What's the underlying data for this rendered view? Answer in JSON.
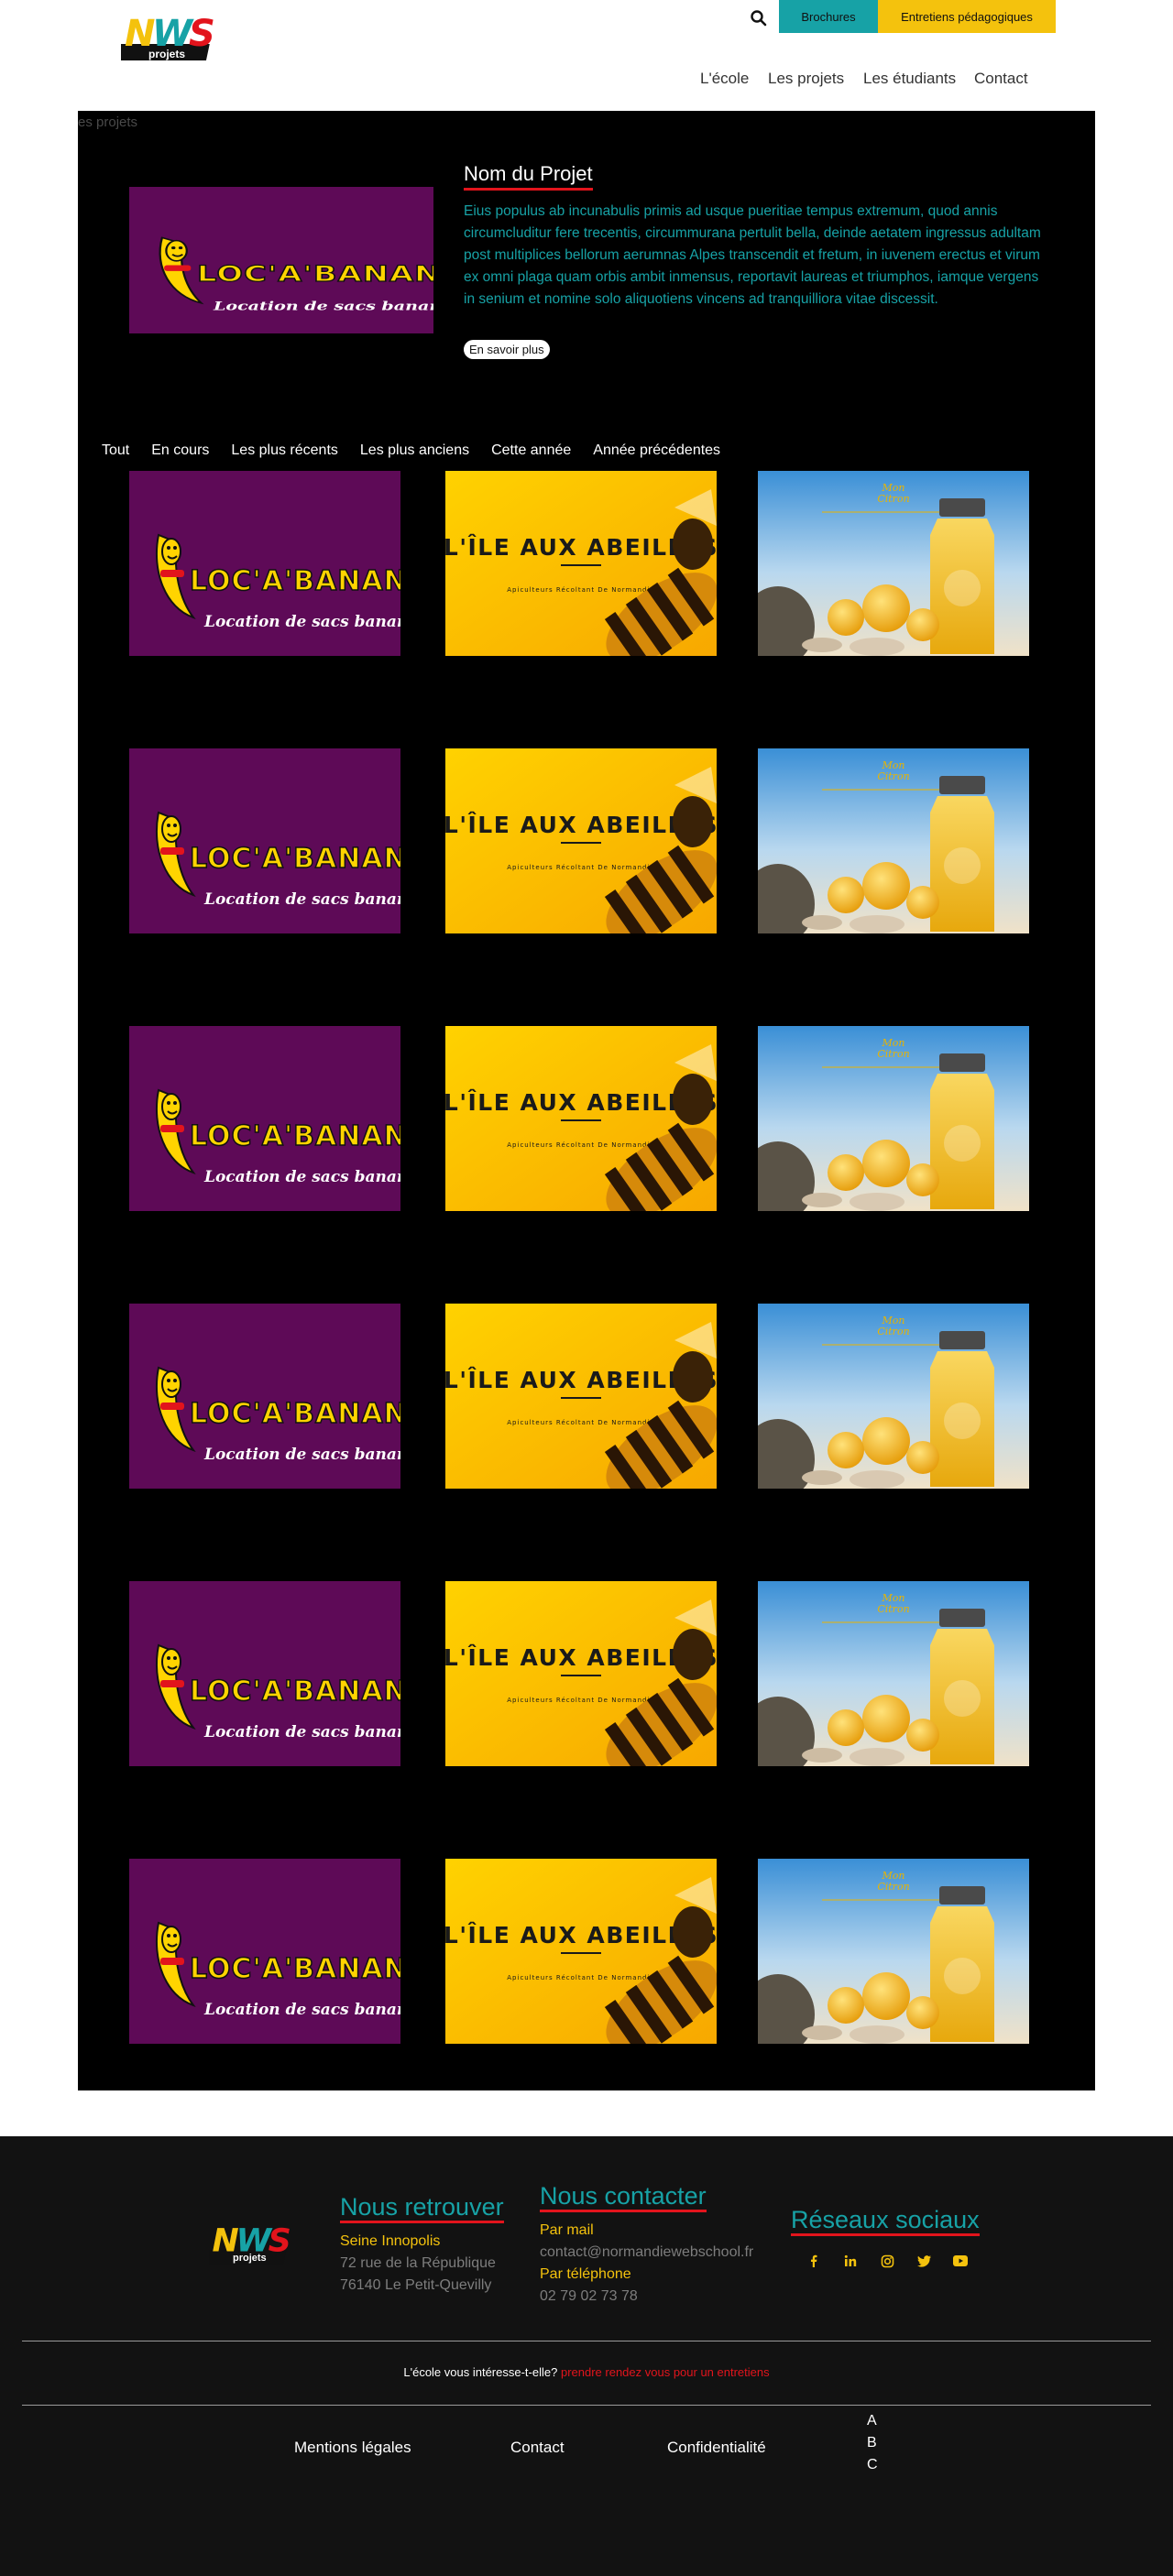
{
  "header": {
    "logo_text": "NWS",
    "logo_sub": "projets",
    "btn_brochures": "Brochures",
    "btn_entretiens": "Entretiens pédagogiques",
    "nav": [
      "L'école",
      "Les projets",
      "Les étudiants",
      "Contact"
    ]
  },
  "main": {
    "breadcrumb": "es projets",
    "featured": {
      "title": "Nom du Projet",
      "description": "Eius populus ab incunabulis primis ad usque pueritiae tempus extremum, quod annis circumcluditur fere trecentis, circummurana pertulit bella, deinde aetatem ingressus adultam post multiplices bellorum aerumnas Alpes transcendit et fretum, in iuvenem erectus et virum ex omni plaga quam orbis ambit inmensus, reportavit laureas et triumphos, iamque vergens in senium et nomine solo aliquotiens vincens ad tranquilliora vitae discessit.",
      "button": "En savoir plus"
    },
    "filters": [
      "Tout",
      "En cours",
      "Les plus récents",
      "Les plus anciens",
      "Cette année",
      "Année précédentes"
    ],
    "thumbs": {
      "banana_title": "LOC'A'BANANE",
      "banana_sub": "Location de sacs banane",
      "bee_title": "L'ÎLE AUX ABEILLES",
      "bee_sub": "Apiculteurs Récoltant De Normandie",
      "juice_brand": "Mon Citron"
    }
  },
  "footer": {
    "logo_text": "NWS",
    "logo_sub": "projets",
    "find_us": {
      "heading": "Nous retrouver",
      "name": "Seine Innopolis",
      "address1": "72 rue de la République",
      "address2": "76140 Le Petit-Quevilly"
    },
    "contact": {
      "heading": "Nous contacter",
      "mail_label": "Par mail",
      "mail": "contact@normandiewebschool.fr",
      "phone_label": "Par téléphone",
      "phone": "02 79 02 73 78"
    },
    "social": {
      "heading": "Réseaux sociaux"
    },
    "cta_text": "L'école vous intéresse-t-elle?",
    "cta_link": "prendre rendez vous pour un entretiens",
    "links": [
      "Mentions légales",
      "Contact",
      "Confidentialité"
    ],
    "abc": [
      "A",
      "B",
      "C"
    ]
  },
  "colors": {
    "teal": "#17a2a6",
    "yellow": "#f4c20d",
    "red": "#e2141c",
    "purple": "#5e0a57",
    "black": "#000000",
    "footer_bg": "#121212"
  }
}
